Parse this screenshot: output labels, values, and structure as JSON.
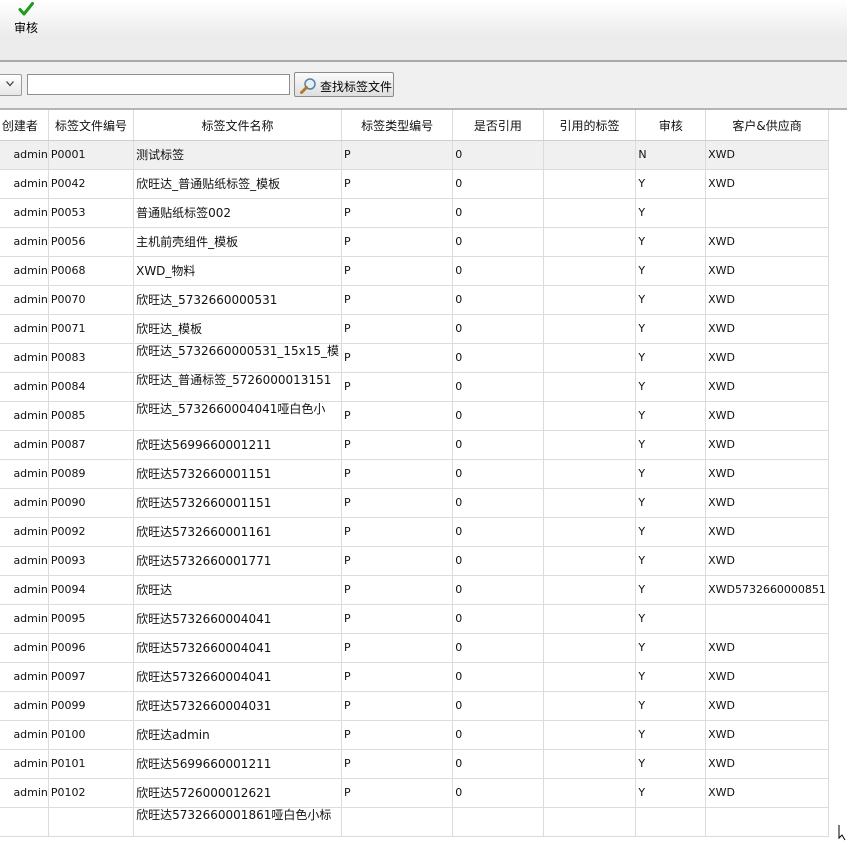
{
  "toolbar": {
    "approve_label": "审核"
  },
  "search": {
    "value": "",
    "button_label": "查找标签文件"
  },
  "columns": [
    "创建者",
    "标签文件编号",
    "标签文件名称",
    "标签类型编号",
    "是否引用",
    "引用的标签",
    "审核",
    "客户&供应商"
  ],
  "rows": [
    {
      "creator": "admin",
      "code": "P0001",
      "name": "测试标签",
      "type": "P",
      "ref": "0",
      "ref_tag": "",
      "audit": "N",
      "customer": "XWD"
    },
    {
      "creator": "admin",
      "code": "P0042",
      "name": "欣旺达_普通贴纸标签_模板",
      "type": "P",
      "ref": "0",
      "ref_tag": "",
      "audit": "Y",
      "customer": "XWD"
    },
    {
      "creator": "admin",
      "code": "P0053",
      "name": "普通贴纸标签002",
      "type": "P",
      "ref": "0",
      "ref_tag": "",
      "audit": "Y",
      "customer": ""
    },
    {
      "creator": "admin",
      "code": "P0056",
      "name": "主机前壳组件_模板",
      "type": "P",
      "ref": "0",
      "ref_tag": "",
      "audit": "Y",
      "customer": "XWD"
    },
    {
      "creator": "admin",
      "code": "P0068",
      "name": "XWD_物料",
      "type": "P",
      "ref": "0",
      "ref_tag": "",
      "audit": "Y",
      "customer": "XWD"
    },
    {
      "creator": "admin",
      "code": "P0070",
      "name": "欣旺达_5732660000531",
      "type": "P",
      "ref": "0",
      "ref_tag": "",
      "audit": "Y",
      "customer": "XWD"
    },
    {
      "creator": "admin",
      "code": "P0071",
      "name": "欣旺达_模板",
      "type": "P",
      "ref": "0",
      "ref_tag": "",
      "audit": "Y",
      "customer": "XWD"
    },
    {
      "creator": "admin",
      "code": "P0083",
      "name": "欣旺达_5732660000531_15x15_模",
      "type": "P",
      "ref": "0",
      "ref_tag": "",
      "audit": "Y",
      "customer": "XWD"
    },
    {
      "creator": "admin",
      "code": "P0084",
      "name": "欣旺达_普通标签_5726000013151",
      "type": "P",
      "ref": "0",
      "ref_tag": "",
      "audit": "Y",
      "customer": "XWD"
    },
    {
      "creator": "admin",
      "code": "P0085",
      "name": "欣旺达_5732660004041哑白色小",
      "type": "P",
      "ref": "0",
      "ref_tag": "",
      "audit": "Y",
      "customer": "XWD"
    },
    {
      "creator": "admin",
      "code": "P0087",
      "name": "欣旺达5699660001211",
      "type": "P",
      "ref": "0",
      "ref_tag": "",
      "audit": "Y",
      "customer": "XWD"
    },
    {
      "creator": "admin",
      "code": "P0089",
      "name": "欣旺达5732660001151",
      "type": "P",
      "ref": "0",
      "ref_tag": "",
      "audit": "Y",
      "customer": "XWD"
    },
    {
      "creator": "admin",
      "code": "P0090",
      "name": "欣旺达5732660001151",
      "type": "P",
      "ref": "0",
      "ref_tag": "",
      "audit": "Y",
      "customer": "XWD"
    },
    {
      "creator": "admin",
      "code": "P0092",
      "name": "欣旺达5732660001161",
      "type": "P",
      "ref": "0",
      "ref_tag": "",
      "audit": "Y",
      "customer": "XWD"
    },
    {
      "creator": "admin",
      "code": "P0093",
      "name": "欣旺达5732660001771",
      "type": "P",
      "ref": "0",
      "ref_tag": "",
      "audit": "Y",
      "customer": "XWD"
    },
    {
      "creator": "admin",
      "code": "P0094",
      "name": "欣旺达",
      "type": "P",
      "ref": "0",
      "ref_tag": "",
      "audit": "Y",
      "customer": "XWD5732660000851"
    },
    {
      "creator": "admin",
      "code": "P0095",
      "name": "欣旺达5732660004041",
      "type": "P",
      "ref": "0",
      "ref_tag": "",
      "audit": "Y",
      "customer": ""
    },
    {
      "creator": "admin",
      "code": "P0096",
      "name": "欣旺达5732660004041",
      "type": "P",
      "ref": "0",
      "ref_tag": "",
      "audit": "Y",
      "customer": "XWD"
    },
    {
      "creator": "admin",
      "code": "P0097",
      "name": "欣旺达5732660004041",
      "type": "P",
      "ref": "0",
      "ref_tag": "",
      "audit": "Y",
      "customer": "XWD"
    },
    {
      "creator": "admin",
      "code": "P0099",
      "name": "欣旺达5732660004031",
      "type": "P",
      "ref": "0",
      "ref_tag": "",
      "audit": "Y",
      "customer": "XWD"
    },
    {
      "creator": "admin",
      "code": "P0100",
      "name": "欣旺达admin",
      "type": "P",
      "ref": "0",
      "ref_tag": "",
      "audit": "Y",
      "customer": "XWD"
    },
    {
      "creator": "admin",
      "code": "P0101",
      "name": "欣旺达5699660001211",
      "type": "P",
      "ref": "0",
      "ref_tag": "",
      "audit": "Y",
      "customer": "XWD"
    },
    {
      "creator": "admin",
      "code": "P0102",
      "name": "欣旺达5726000012621",
      "type": "P",
      "ref": "0",
      "ref_tag": "",
      "audit": "Y",
      "customer": "XWD"
    },
    {
      "creator": "",
      "code": "",
      "name": "欣旺达5732660001861哑白色小标",
      "type": "",
      "ref": "",
      "ref_tag": "",
      "audit": "",
      "customer": ""
    }
  ],
  "icons": {
    "approve": "checkmark-icon",
    "search": "magnifier-icon",
    "dropdown": "chevron-down-icon"
  },
  "colors": {
    "check_green": "#1e9a1e",
    "selected_row": "#f0f0f0"
  }
}
